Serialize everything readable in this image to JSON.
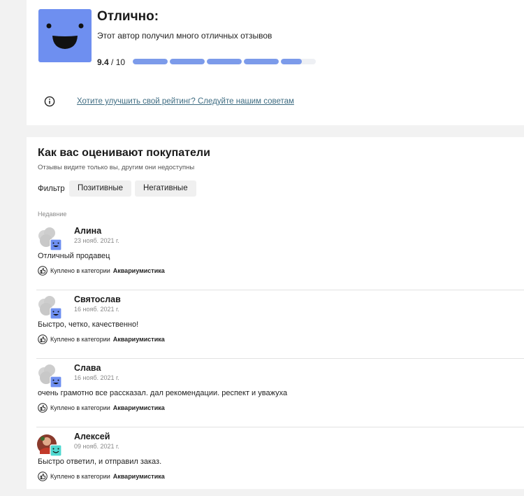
{
  "rating": {
    "title": "Отлично:",
    "description": "Этот автор получил много отличных отзывов",
    "score": "9.4",
    "out_of": "/ 10",
    "bar_fill_fractions": [
      1,
      1,
      1,
      1,
      0.6
    ],
    "accent_color": "#6e8ff0",
    "tip_link": "Хотите улучшить свой рейтинг? Следуйте нашим советам"
  },
  "reviews": {
    "title": "Как вас оценивают покупатели",
    "subtitle": "Отзывы видите только вы, другим они недоступны",
    "filter_label": "Фильтр",
    "filters": [
      "Позитивные",
      "Негативные"
    ],
    "section_label": "Недавние",
    "purchase_prefix": "Куплено в категории",
    "items": [
      {
        "author": "Алина",
        "date": "23 нояб. 2021 г.",
        "text": "Отличный продавец",
        "category": "Аквариумистика",
        "avatar": "placeholder"
      },
      {
        "author": "Святослав",
        "date": "16 нояб. 2021 г.",
        "text": "Быстро, четко, качественно!",
        "category": "Аквариумистика",
        "avatar": "placeholder"
      },
      {
        "author": "Слава",
        "date": "16 нояб. 2021 г.",
        "text": "очень грамотно все рассказал. дал рекомендации. респект и уважуха",
        "category": "Аквариумистика",
        "avatar": "placeholder"
      },
      {
        "author": "Алексей",
        "date": "09 нояб. 2021 г.",
        "text": "Быстро ответил, и отправил заказ.",
        "category": "Аквариумистика",
        "avatar": "photo"
      }
    ]
  }
}
